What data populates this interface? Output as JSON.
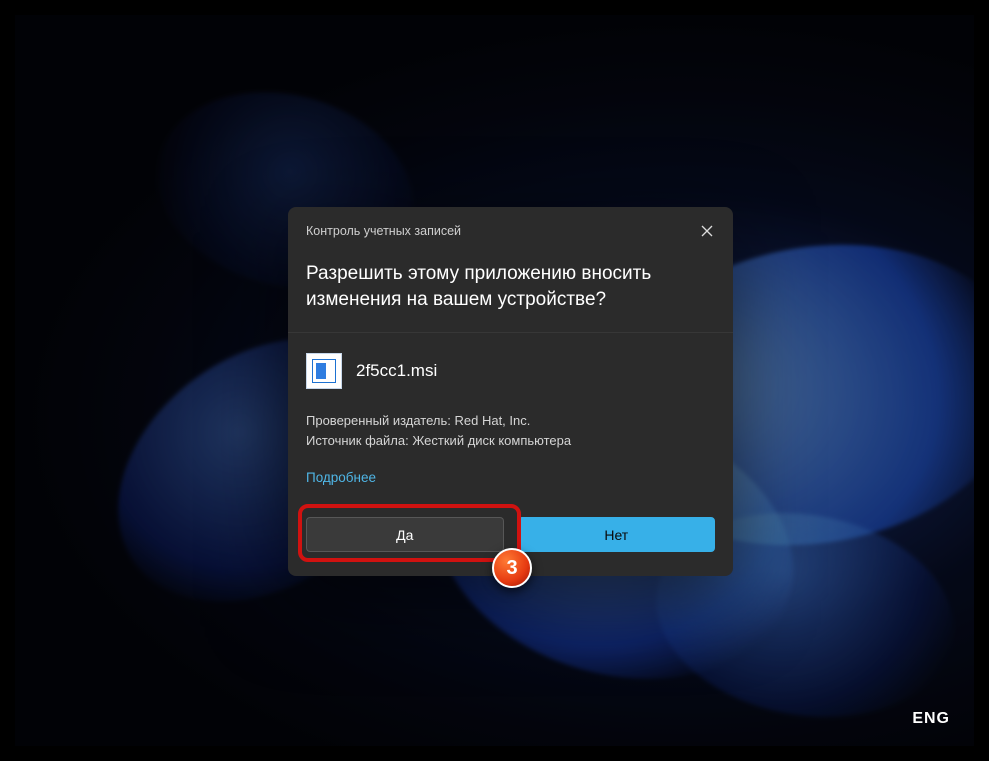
{
  "dialog": {
    "title": "Контроль учетных записей",
    "question": "Разрешить этому приложению вносить изменения на вашем устройстве?",
    "app_name": "2f5cc1.msi",
    "publisher_line": "Проверенный издатель: Red Hat, Inc.",
    "origin_line": "Источник файла: Жесткий диск компьютера",
    "more_label": "Подробнее",
    "yes_label": "Да",
    "no_label": "Нет"
  },
  "annotation": {
    "step_number": "3"
  },
  "system": {
    "input_language": "ENG"
  }
}
